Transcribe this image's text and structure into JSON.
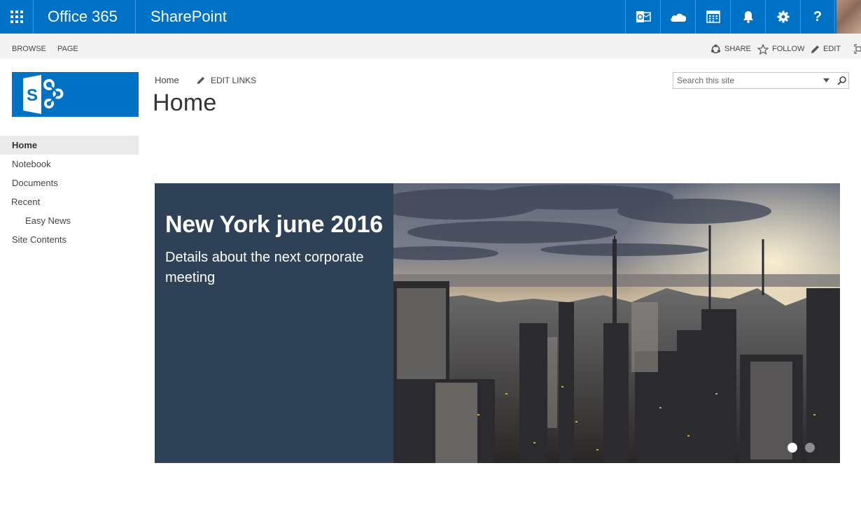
{
  "suite_bar": {
    "app_launcher_icon": "waffle-icon",
    "brand": "Office 365",
    "app_name": "SharePoint",
    "icons": [
      "outlook-icon",
      "onedrive-icon",
      "calendar-icon",
      "bell-icon",
      "gear-icon",
      "help-icon"
    ],
    "help_glyph": "?",
    "outlook_letter": "O",
    "color": "#0072c6"
  },
  "ribbon": {
    "tabs": [
      "BROWSE",
      "PAGE"
    ],
    "share": "SHARE",
    "follow": "FOLLOW",
    "edit": "EDIT"
  },
  "site_logo": {
    "letter": "S",
    "color": "#0072c6"
  },
  "breadcrumb": {
    "home": "Home",
    "edit_links": "EDIT LINKS"
  },
  "page_title": "Home",
  "search": {
    "placeholder": "Search this site"
  },
  "quick_launch": {
    "home": "Home",
    "notebook": "Notebook",
    "documents": "Documents",
    "recent": "Recent",
    "easy_news": "Easy News",
    "site_contents": "Site Contents"
  },
  "hero": {
    "title": "New York june 2016",
    "subtitle": "Details about the next corporate meeting",
    "panel_color": "#2e4156",
    "slides_total": 2,
    "active_slide": 1
  }
}
